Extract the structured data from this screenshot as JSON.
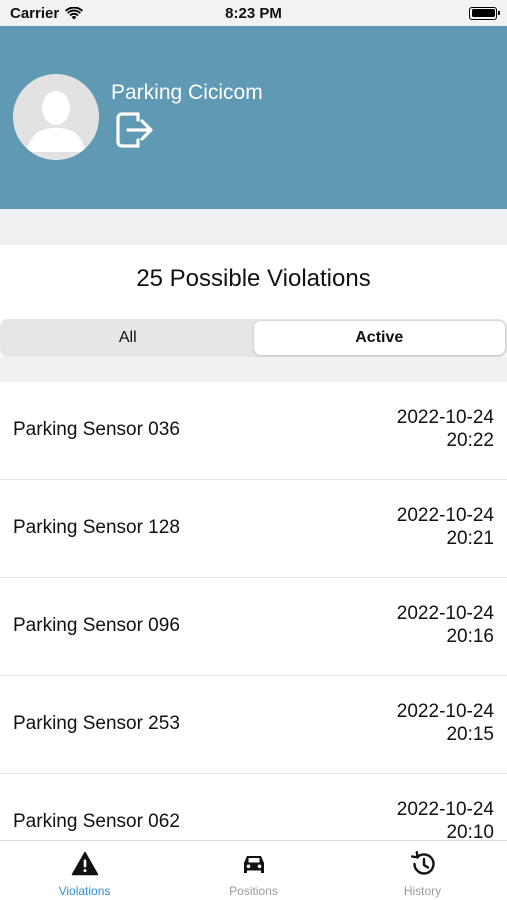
{
  "status_bar": {
    "carrier": "Carrier",
    "time": "8:23 PM"
  },
  "profile": {
    "name": "Parking Cicicom",
    "avatar_icon": "person-placeholder-icon",
    "logout_icon": "logout-icon"
  },
  "violations": {
    "title": "25 Possible Violations",
    "segments": {
      "all": "All",
      "active": "Active",
      "selected": "Active"
    },
    "items": [
      {
        "name": "Parking Sensor 036",
        "date": "2022-10-24",
        "time": "20:22"
      },
      {
        "name": "Parking Sensor 128",
        "date": "2022-10-24",
        "time": "20:21"
      },
      {
        "name": "Parking Sensor 096",
        "date": "2022-10-24",
        "time": "20:16"
      },
      {
        "name": "Parking Sensor 253",
        "date": "2022-10-24",
        "time": "20:15"
      },
      {
        "name": "Parking Sensor 062",
        "date": "2022-10-24",
        "time": "20:10"
      }
    ]
  },
  "tab_bar": {
    "violations": "Violations",
    "positions": "Positions",
    "history": "History",
    "selected": "Violations",
    "active_color": "#2f8fdc",
    "inactive_color": "#9a9a9a"
  },
  "colors": {
    "header_bg": "#5f99b4",
    "band_bg": "#f1f1f3"
  }
}
